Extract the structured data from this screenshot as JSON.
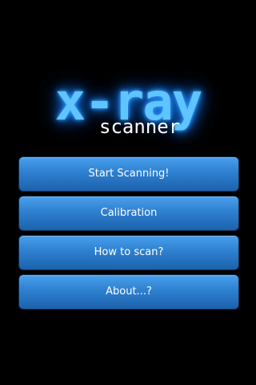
{
  "logo": {
    "title": "x-ray",
    "subtitle": "scanner",
    "glow_color": "#1e88ff"
  },
  "menu": {
    "items": [
      {
        "label": "Start Scanning!"
      },
      {
        "label": "Calibration"
      },
      {
        "label": "How to scan?"
      },
      {
        "label": "About...?"
      }
    ]
  },
  "colors": {
    "background": "#000000",
    "button_top": "#4aa0ec",
    "button_bottom": "#1c62ad",
    "button_text": "#ffffff"
  }
}
